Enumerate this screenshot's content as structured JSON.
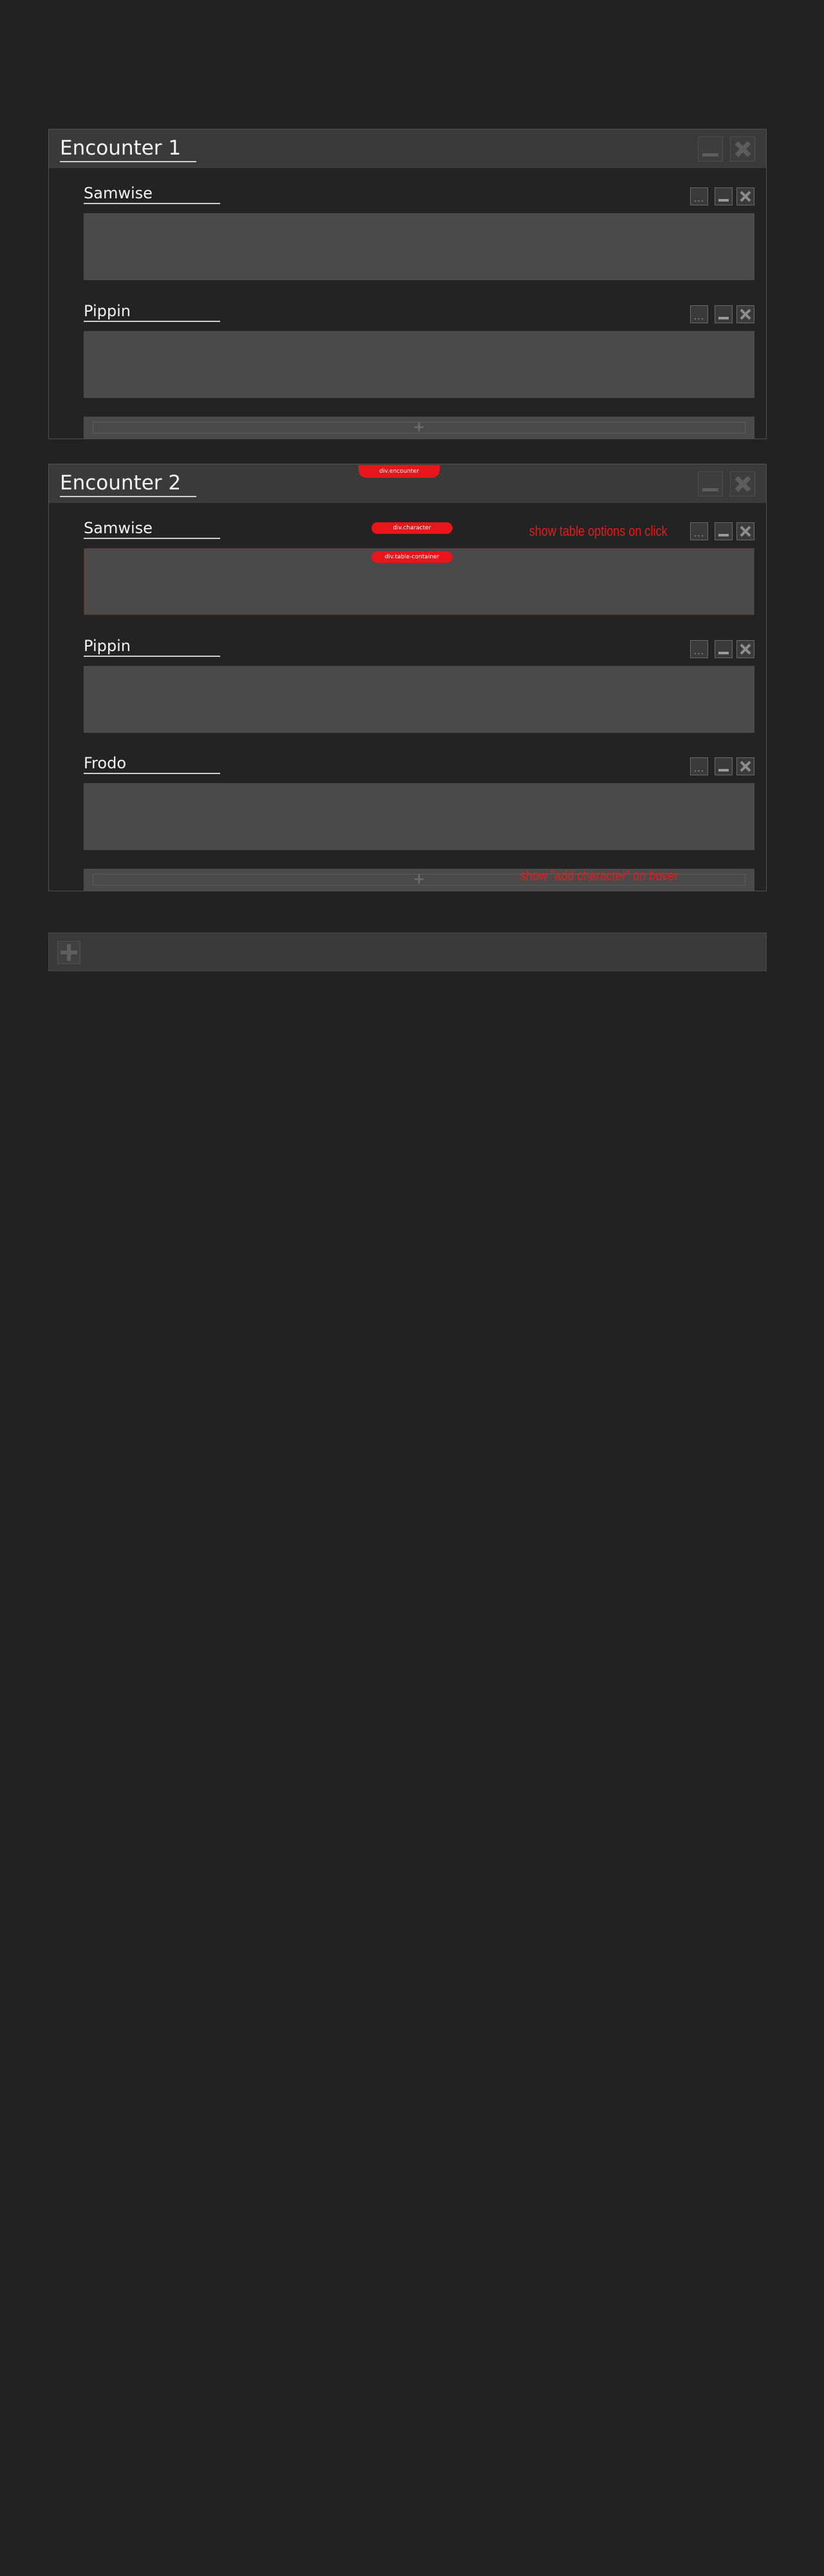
{
  "encounters": [
    {
      "title": "Encounter 1",
      "characters": [
        {
          "name": "Samwise",
          "options_label": "..."
        },
        {
          "name": "Pippin",
          "options_label": "..."
        }
      ],
      "add_character_label": "+"
    },
    {
      "title": "Encounter 2",
      "characters": [
        {
          "name": "Samwise",
          "options_label": "..."
        },
        {
          "name": "Pippin",
          "options_label": "..."
        },
        {
          "name": "Frodo",
          "options_label": "..."
        }
      ],
      "add_character_label": "+"
    }
  ],
  "annotations": {
    "encounter_tag": "div.encounter",
    "character_tag": "div.character",
    "table_container_tag": "div.table-container",
    "table_options_note": "show table options on click",
    "add_character_note": "show \"add character\" on hover"
  },
  "colors": {
    "background": "#222222",
    "panel_header": "#3a3a3a",
    "table_area": "#4a4a4a",
    "annotation_red": "#e8151a"
  },
  "icons": {
    "minimize": "minimize-icon",
    "close": "close-icon",
    "options": "ellipsis-icon",
    "add": "plus-icon"
  }
}
